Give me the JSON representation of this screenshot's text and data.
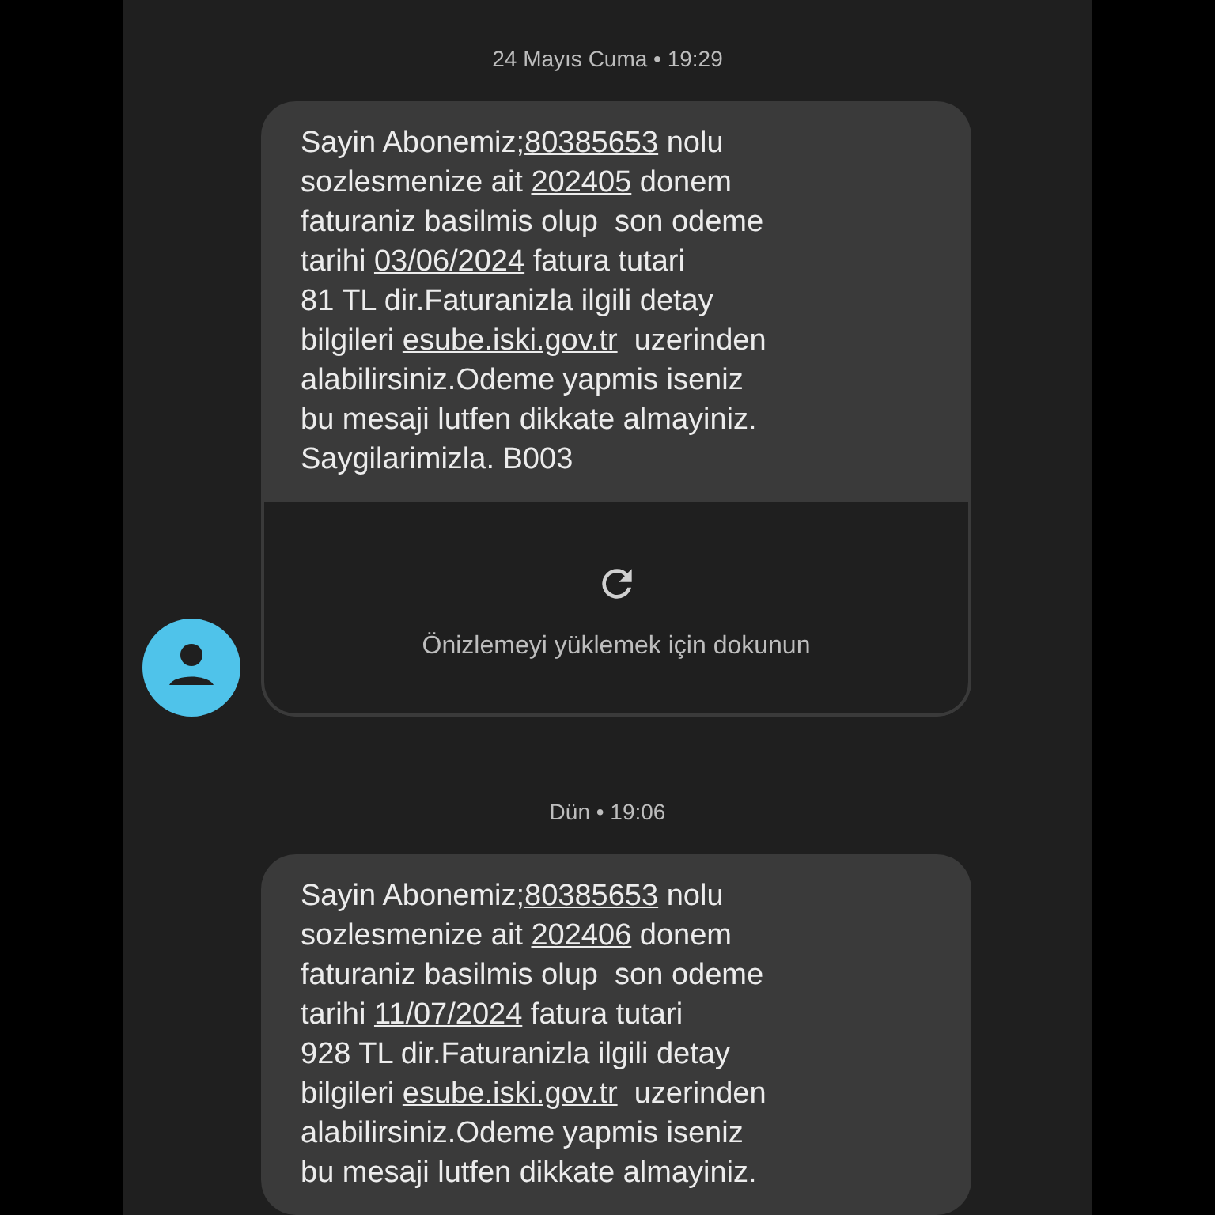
{
  "conversation": [
    {
      "kind": "timestamp",
      "text": "24 Mayıs Cuma • 19:29"
    },
    {
      "kind": "message",
      "avatar": true,
      "lines": [
        [
          {
            "text": "Sayin Abonemiz;",
            "link": false
          },
          {
            "text": "80385653",
            "link": true
          },
          {
            "text": " nolu",
            "link": false
          }
        ],
        [
          {
            "text": "sozlesmenize ait ",
            "link": false
          },
          {
            "text": "202405",
            "link": true
          },
          {
            "text": " donem",
            "link": false
          }
        ],
        [
          {
            "text": "faturaniz basilmis olup  son odeme",
            "link": false
          }
        ],
        [
          {
            "text": "tarihi ",
            "link": false
          },
          {
            "text": "03/06/2024",
            "link": true
          },
          {
            "text": " fatura tutari",
            "link": false
          }
        ],
        [
          {
            "text": "81 TL dir.Faturanizla ilgili detay",
            "link": false
          }
        ],
        [
          {
            "text": "bilgileri ",
            "link": false
          },
          {
            "text": "esube.iski.gov.tr",
            "link": true
          },
          {
            "text": "  uzerinden",
            "link": false
          }
        ],
        [
          {
            "text": "alabilirsiniz.Odeme yapmis iseniz",
            "link": false
          }
        ],
        [
          {
            "text": "bu mesaji lutfen dikkate almayiniz.",
            "link": false
          }
        ],
        [
          {
            "text": "Saygilarimizla. B003",
            "link": false
          }
        ]
      ],
      "preview": {
        "text": "Önizlemeyi yüklemek için dokunun"
      }
    },
    {
      "kind": "timestamp",
      "text": "Dün • 19:06"
    },
    {
      "kind": "message",
      "avatar": false,
      "lines": [
        [
          {
            "text": "Sayin Abonemiz;",
            "link": false
          },
          {
            "text": "80385653",
            "link": true
          },
          {
            "text": " nolu",
            "link": false
          }
        ],
        [
          {
            "text": "sozlesmenize ait ",
            "link": false
          },
          {
            "text": "202406",
            "link": true
          },
          {
            "text": " donem",
            "link": false
          }
        ],
        [
          {
            "text": "faturaniz basilmis olup  son odeme",
            "link": false
          }
        ],
        [
          {
            "text": "tarihi ",
            "link": false
          },
          {
            "text": "11/07/2024",
            "link": true
          },
          {
            "text": " fatura tutari",
            "link": false
          }
        ],
        [
          {
            "text": "928 TL dir.Faturanizla ilgili detay",
            "link": false
          }
        ],
        [
          {
            "text": "bilgileri ",
            "link": false
          },
          {
            "text": "esube.iski.gov.tr",
            "link": true
          },
          {
            "text": "  uzerinden",
            "link": false
          }
        ],
        [
          {
            "text": "alabilirsiniz.Odeme yapmis iseniz",
            "link": false
          }
        ],
        [
          {
            "text": "bu mesaji lutfen dikkate almayiniz.",
            "link": false
          }
        ]
      ]
    }
  ]
}
